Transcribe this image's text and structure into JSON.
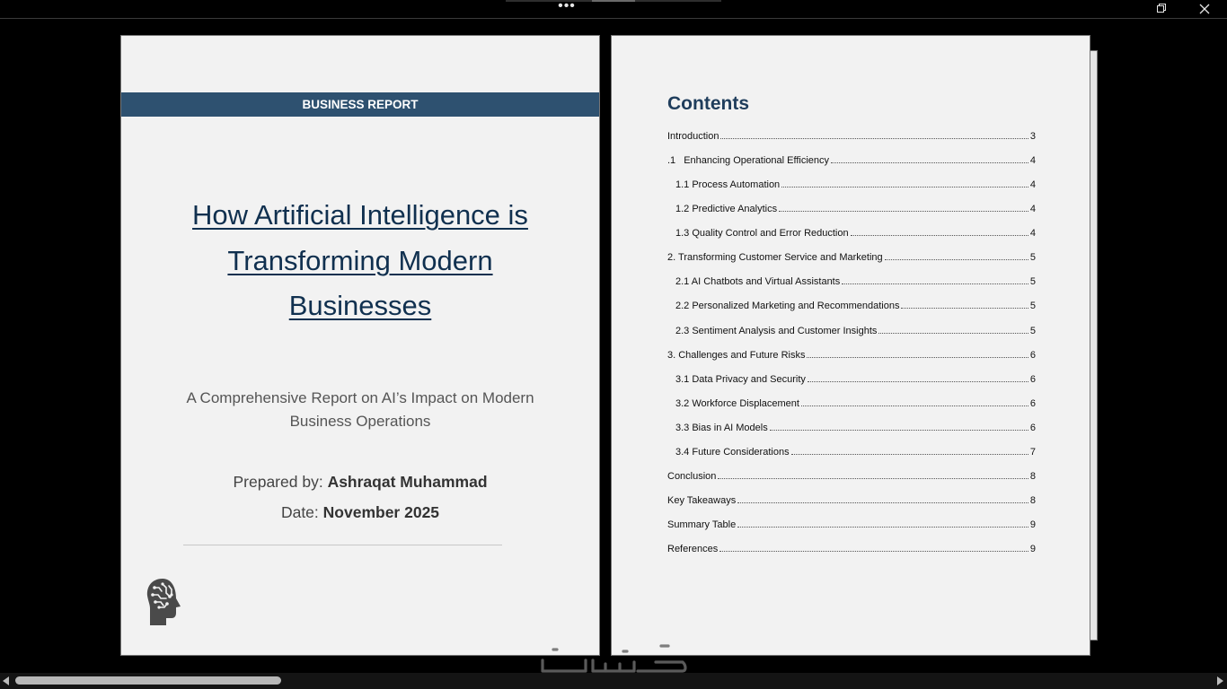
{
  "toolbar": {
    "more_label": "•••"
  },
  "cover": {
    "banner": "BUSINESS REPORT",
    "title_lines": [
      "How Artificial Intelligence is",
      "Transforming Modern",
      "Businesses"
    ],
    "subtitle": "A Comprehensive Report on AI’s Impact on Modern Business Operations",
    "prepared_label": "Prepared by:",
    "prepared_name": "Ashraqat Muhammad",
    "date_label": "Date:",
    "date_value": "November 2025",
    "icon": "brain-circuit-head-icon"
  },
  "toc": {
    "heading": "Contents",
    "entries": [
      {
        "num": "",
        "text": "Introduction",
        "page": "3"
      },
      {
        "num": ".1",
        "text": "Enhancing Operational Efficiency",
        "page": "4"
      },
      {
        "num": "",
        "text": "1.1 Process Automation",
        "page": "4"
      },
      {
        "num": "",
        "text": "1.2 Predictive Analytics",
        "page": "4"
      },
      {
        "num": "",
        "text": "1.3 Quality Control and Error Reduction",
        "page": "4"
      },
      {
        "num": "",
        "text": "2. Transforming Customer Service and Marketing",
        "page": "5"
      },
      {
        "num": "",
        "text": "2.1 AI Chatbots and Virtual Assistants",
        "page": "5"
      },
      {
        "num": "",
        "text": "2.2 Personalized Marketing and Recommendations",
        "page": "5"
      },
      {
        "num": "",
        "text": "2.3 Sentiment Analysis and Customer Insights",
        "page": "5"
      },
      {
        "num": "",
        "text": "3. Challenges and Future Risks",
        "page": "6"
      },
      {
        "num": "",
        "text": "3.1 Data Privacy and Security",
        "page": "6"
      },
      {
        "num": "",
        "text": "3.2 Workforce Displacement",
        "page": "6"
      },
      {
        "num": "",
        "text": "3.3 Bias in AI Models",
        "page": "6"
      },
      {
        "num": "",
        "text": "3.4 Future Considerations",
        "page": "7"
      },
      {
        "num": "",
        "text": "Conclusion",
        "page": "8"
      },
      {
        "num": "",
        "text": "Key Takeaways",
        "page": "8"
      },
      {
        "num": "",
        "text": "Summary Table",
        "page": "9"
      },
      {
        "num": "",
        "text": "References",
        "page": "9"
      }
    ]
  },
  "colors": {
    "banner": "#2e5170",
    "title": "#10304f",
    "toc_heading": "#1f3d5c",
    "page": "#f2f2f2"
  }
}
